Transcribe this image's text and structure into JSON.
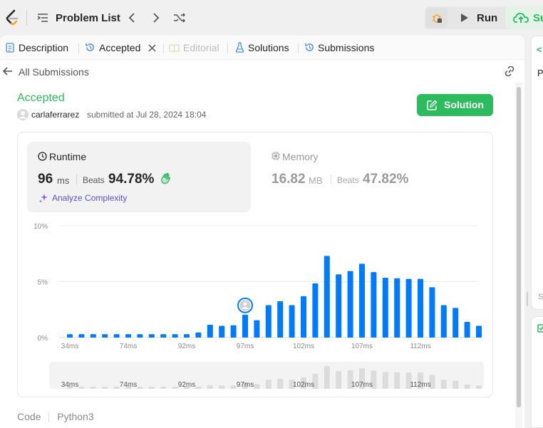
{
  "topbar": {
    "problem_list_label": "Problem List",
    "run_label": "Run",
    "submit_label": "Su"
  },
  "tabs": [
    {
      "label": "Description"
    },
    {
      "label": "Accepted"
    },
    {
      "label": "Editorial"
    },
    {
      "label": "Solutions"
    },
    {
      "label": "Submissions"
    }
  ],
  "subnav": {
    "back_label": "All Submissions"
  },
  "submission": {
    "status": "Accepted",
    "username": "carlaferrarez",
    "submitted_text": "submitted at Jul 28, 2024 18:04",
    "solution_button": "Solution"
  },
  "runtime": {
    "title": "Runtime",
    "value": "96",
    "unit": "ms",
    "beats_label": "Beats",
    "beats_value": "94.78%",
    "analyze_label": "Analyze Complexity"
  },
  "memory": {
    "title": "Memory",
    "value": "16.82",
    "unit": "MB",
    "beats_label": "Beats",
    "beats_value": "47.82%"
  },
  "footer": {
    "code_label": "Code",
    "language": "Python3"
  },
  "colors": {
    "accent": "#2cbb5d",
    "bar": "#007aff",
    "purple": "#8b5cf6"
  },
  "chart_data": {
    "type": "bar",
    "ylabel_ticks": [
      "10%",
      "5%",
      "0%"
    ],
    "ylim": [
      0,
      10
    ],
    "grid": true,
    "x_tick_labels": [
      "34ms",
      "74ms",
      "92ms",
      "97ms",
      "102ms",
      "107ms",
      "112ms"
    ],
    "values": [
      0.3,
      0.3,
      0.3,
      0.3,
      0.3,
      0.3,
      0.3,
      0.3,
      0.3,
      0.3,
      0.3,
      0.45,
      1.15,
      1.05,
      1.1,
      2.05,
      1.55,
      2.9,
      3.25,
      2.9,
      3.7,
      4.85,
      7.3,
      5.65,
      5.95,
      6.6,
      5.85,
      5.35,
      5.3,
      5.25,
      5.25,
      4.5,
      2.9,
      2.65,
      1.4,
      1.05
    ],
    "highlight_index": 15,
    "mini_tick_labels": [
      "34ms",
      "74ms",
      "92ms",
      "97ms",
      "102ms",
      "107ms",
      "112ms"
    ]
  }
}
